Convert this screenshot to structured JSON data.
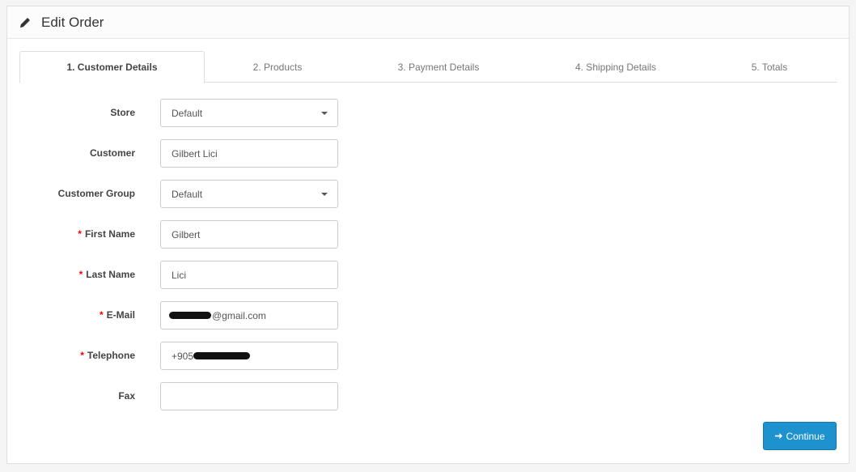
{
  "header": {
    "icon": "pencil-icon",
    "title": "Edit Order"
  },
  "tabs": [
    {
      "label": "1. Customer Details",
      "active": true
    },
    {
      "label": "2. Products",
      "active": false
    },
    {
      "label": "3. Payment Details",
      "active": false
    },
    {
      "label": "4. Shipping Details",
      "active": false
    },
    {
      "label": "5. Totals",
      "active": false
    }
  ],
  "form": {
    "store": {
      "label": "Store",
      "value": "Default",
      "required": false
    },
    "customer": {
      "label": "Customer",
      "value": "Gilbert Lici",
      "required": false
    },
    "customer_group": {
      "label": "Customer Group",
      "value": "Default",
      "required": false
    },
    "first_name": {
      "label": "First Name",
      "value": "Gilbert",
      "required": true
    },
    "last_name": {
      "label": "Last Name",
      "value": "Lici",
      "required": true
    },
    "email": {
      "label": "E-Mail",
      "value_visible": "@gmail.com",
      "redacted": true,
      "required": true
    },
    "telephone": {
      "label": "Telephone",
      "value_visible": "+905",
      "redacted": true,
      "required": true
    },
    "fax": {
      "label": "Fax",
      "value": "",
      "required": false
    },
    "required_marker": "*"
  },
  "actions": {
    "continue_label": "Continue",
    "continue_icon": "arrow-right-icon",
    "colors": {
      "primary": "#1e91cf",
      "required": "#ff0000"
    }
  }
}
